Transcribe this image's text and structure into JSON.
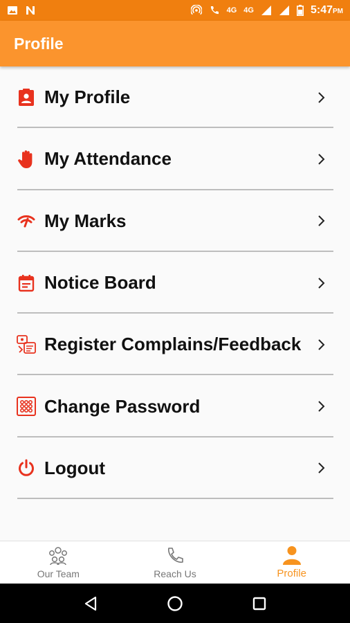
{
  "status_bar": {
    "time": "5:47",
    "time_suffix": "PM",
    "network_1": "4G",
    "network_2": "4G",
    "left_icons": [
      "image-icon",
      "notification-n-icon"
    ],
    "right_icons": [
      "hotspot-icon",
      "wifi-call-icon",
      "signal-icon",
      "signal-icon",
      "battery-icon"
    ]
  },
  "app_bar": {
    "title": "Profile"
  },
  "colors": {
    "status_bar": "#f07f0f",
    "app_bar": "#fb942d",
    "icon_accent": "#e8321e",
    "active_tab": "#f7931e"
  },
  "menu": {
    "items": [
      {
        "label": "My Profile",
        "icon": "id-card-icon"
      },
      {
        "label": "My Attendance",
        "icon": "raised-hand-icon"
      },
      {
        "label": "My Marks",
        "icon": "marks-icon"
      },
      {
        "label": "Notice Board",
        "icon": "calendar-icon"
      },
      {
        "label": "Register Complains/Feedback",
        "icon": "feedback-icon"
      },
      {
        "label": "Change Password",
        "icon": "keypad-icon"
      },
      {
        "label": "Logout",
        "icon": "power-icon"
      }
    ]
  },
  "bottom_nav": {
    "tabs": [
      {
        "label": "Our Team",
        "icon": "team-icon",
        "active": false
      },
      {
        "label": "Reach Us",
        "icon": "phone-icon",
        "active": false
      },
      {
        "label": "Profile",
        "icon": "person-icon",
        "active": true
      }
    ]
  },
  "system_nav": {
    "buttons": [
      "back-icon",
      "home-icon",
      "recents-icon"
    ]
  }
}
